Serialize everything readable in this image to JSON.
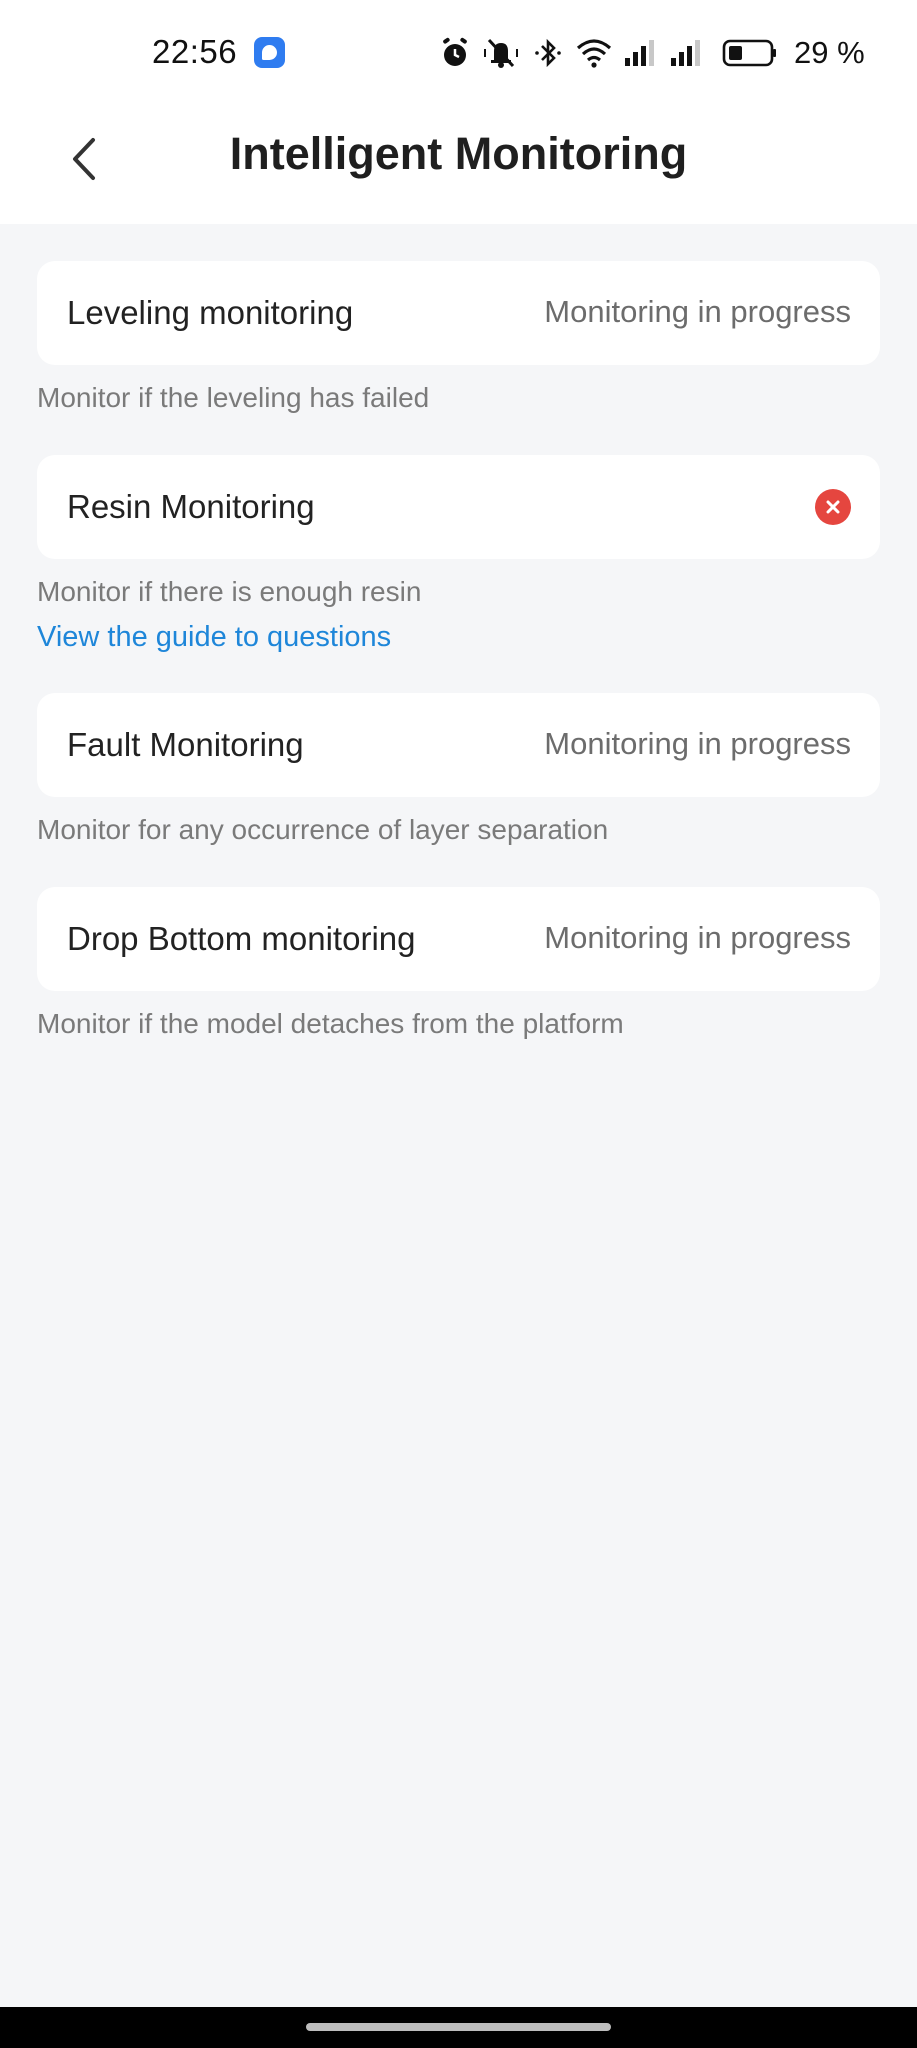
{
  "status_bar": {
    "time": "22:56",
    "battery_text": "29 %",
    "icons": [
      "app-notification-icon",
      "alarm-icon",
      "mute-icon",
      "bluetooth-icon",
      "wifi-icon",
      "signal-icon",
      "signal-icon",
      "battery-icon"
    ]
  },
  "header": {
    "title": "Intelligent Monitoring",
    "back_icon": "chevron-left-icon"
  },
  "items": [
    {
      "label": "Leveling monitoring",
      "status": "Monitoring in progress",
      "description": "Monitor if the leveling has failed"
    },
    {
      "label": "Resin Monitoring",
      "status_icon": "error-x-icon",
      "status_color": "#e5463f",
      "description": "Monitor if there is enough resin",
      "link": "View the guide to questions"
    },
    {
      "label": "Fault Monitoring",
      "status": "Monitoring in progress",
      "description": "Monitor for any occurrence of layer separation"
    },
    {
      "label": "Drop Bottom monitoring",
      "status": "Monitoring in progress",
      "description": "Monitor if the model detaches from the platform"
    }
  ],
  "colors": {
    "background": "#f5f6f8",
    "card": "#ffffff",
    "link": "#1e86d9",
    "error": "#e5463f"
  }
}
